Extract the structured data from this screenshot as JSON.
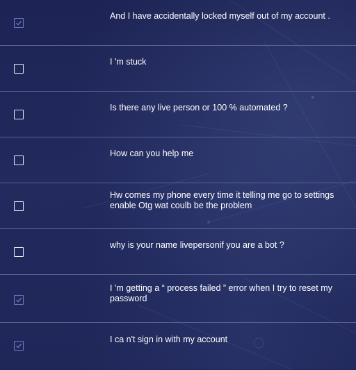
{
  "accent_color": "#6f79c4",
  "utterances": [
    {
      "text": "And I have accidentally locked myself out of my account .",
      "checked": true
    },
    {
      "text": "I 'm stuck",
      "checked": false
    },
    {
      "text": "Is there any live person or 100 % automated ?",
      "checked": false
    },
    {
      "text": "How can you help me",
      "checked": false
    },
    {
      "text": "Hw comes my phone every time it telling me go to settings enable Otg wat coulb be the problem",
      "checked": false
    },
    {
      "text": "why is your name livepersonif you are a bot ?",
      "checked": false
    },
    {
      "text": "I 'm getting a “ process failed ” error when I try to reset my password",
      "checked": true
    },
    {
      "text": "I ca n't sign in with my account",
      "checked": true
    }
  ]
}
